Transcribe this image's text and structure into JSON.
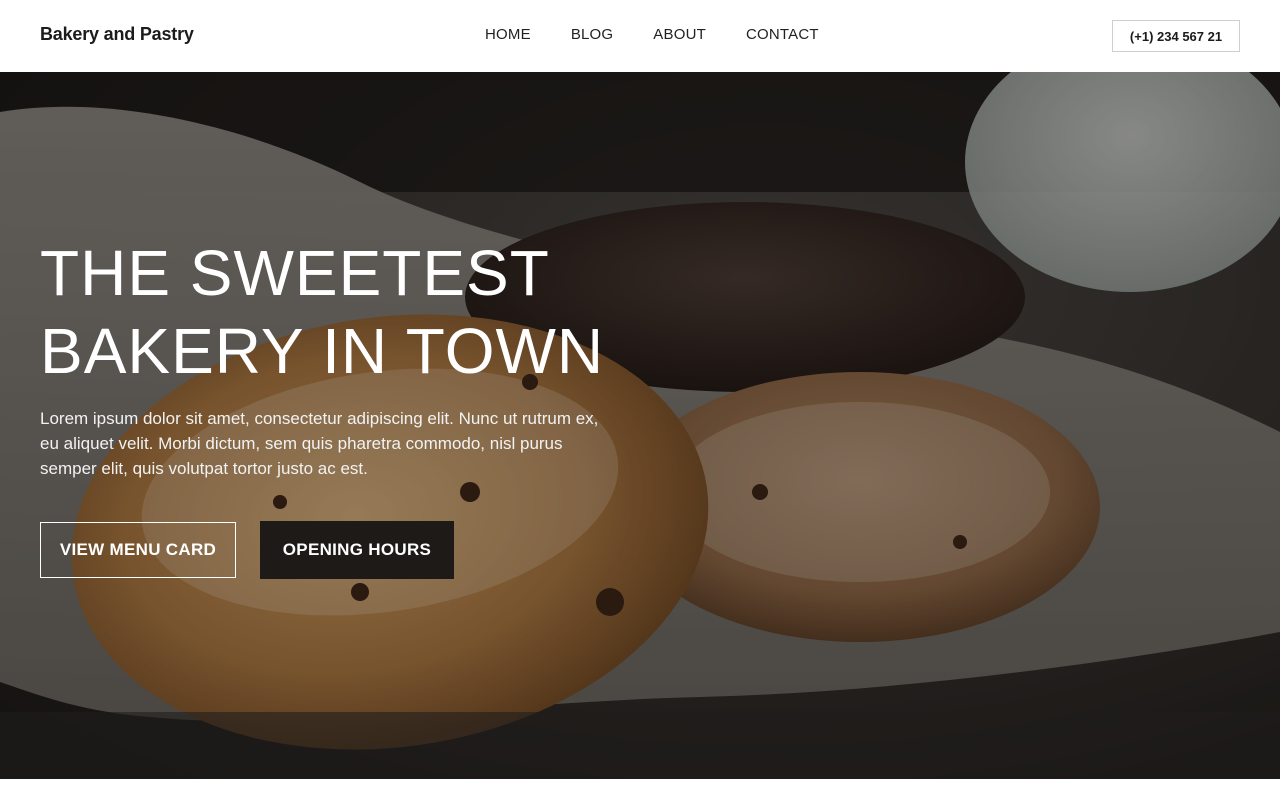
{
  "header": {
    "brand": "Bakery and Pastry",
    "nav": [
      "HOME",
      "BLOG",
      "ABOUT",
      "CONTACT"
    ],
    "phone": "(+1) 234 567 21"
  },
  "hero": {
    "headline_line1": "THE SWEETEST",
    "headline_line2": "BAKERY IN TOWN",
    "description": "Lorem ipsum dolor sit amet, consectetur adipiscing elit. Nunc ut rutrum ex, eu aliquet velit. Morbi dictum, sem quis pharetra commodo, nisl purus semper elit, quis volutpat tortor justo ac est.",
    "primary_button": "VIEW MENU CARD",
    "secondary_button": "OPENING HOURS"
  },
  "colors": {
    "header_bg": "#ffffff",
    "text_dark": "#1b1b1b",
    "hero_text": "#ffffff",
    "solid_button": "#1e1a18"
  },
  "images": {
    "hero_photo": "cookies-on-linen-photo"
  }
}
